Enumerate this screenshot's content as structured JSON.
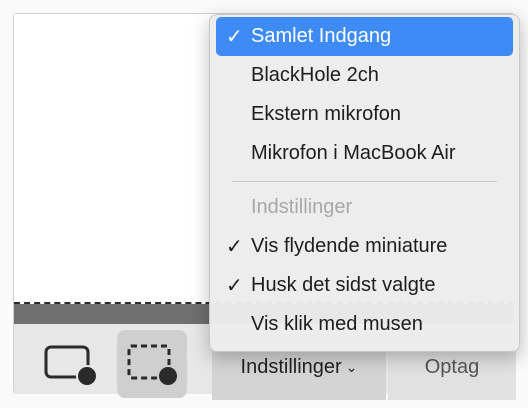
{
  "menu": {
    "items": [
      {
        "label": "Samlet Indgang",
        "checked": true,
        "highlighted": true
      },
      {
        "label": "BlackHole 2ch",
        "checked": false
      },
      {
        "label": "Ekstern mikrofon",
        "checked": false
      },
      {
        "label": "Mikrofon i MacBook Air",
        "checked": false
      }
    ],
    "section_header": "Indstillinger",
    "options": [
      {
        "label": "Vis flydende miniature",
        "checked": true
      },
      {
        "label": "Husk det sidst valgte",
        "checked": true
      },
      {
        "label": "Vis klik med musen",
        "checked": false
      }
    ],
    "check_glyph": "✓"
  },
  "toolbar": {
    "options_label": "Indstillinger",
    "options_chevron": "⌄",
    "record_label": "Optag",
    "tools": [
      {
        "icon": "record-window-icon"
      },
      {
        "icon": "record-selection-icon",
        "selected": true
      }
    ]
  },
  "colors": {
    "highlight": "#3e8bf5",
    "menu_bg": "#ececec",
    "toolbar_bg": "#e7e7e7"
  }
}
